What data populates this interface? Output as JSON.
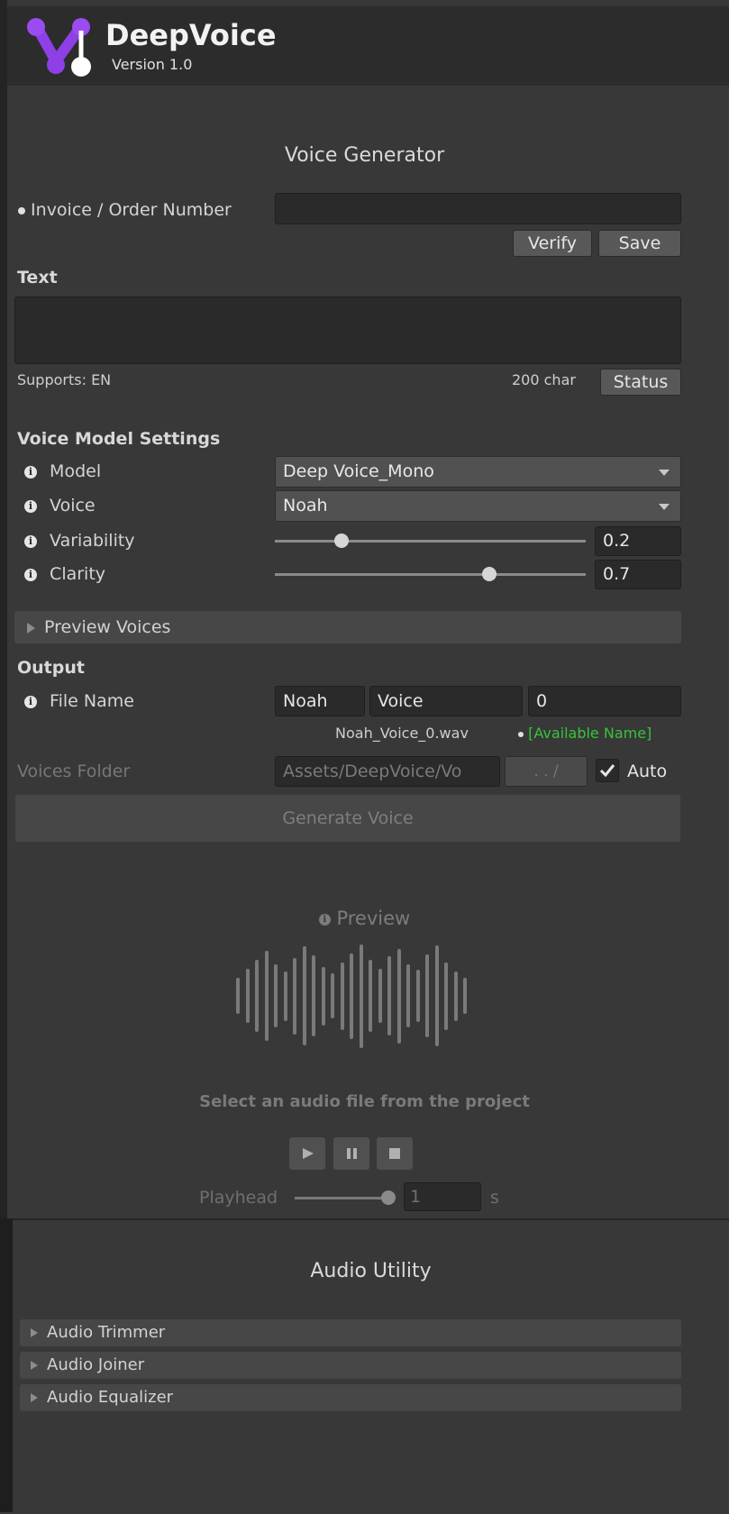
{
  "app": {
    "title": "DeepVoice",
    "version": "Version 1.0"
  },
  "generator": {
    "title": "Voice Generator",
    "invoice_label": "Invoice / Order Number",
    "invoice_value": "",
    "verify_label": "Verify",
    "save_label": "Save",
    "text_label": "Text",
    "text_value": "",
    "supports": "Supports: EN",
    "char_count": "200 char",
    "status_label": "Status"
  },
  "model_settings": {
    "title": "Voice Model Settings",
    "model_label": "Model",
    "model_value": "Deep Voice_Mono",
    "voice_label": "Voice",
    "voice_value": "Noah",
    "variability_label": "Variability",
    "variability_value": "0.2",
    "variability_fraction": 0.2,
    "clarity_label": "Clarity",
    "clarity_value": "0.7",
    "clarity_fraction": 0.7
  },
  "preview_voices_label": "Preview Voices",
  "output": {
    "title": "Output",
    "file_name_label": "File Name",
    "name_part1": "Noah",
    "name_part2": "Voice",
    "name_part3": "0",
    "file_preview": "Noah_Voice_0.wav",
    "availability": "[Available Name]",
    "folder_label": "Voices Folder",
    "folder_value": "Assets/DeepVoice/Vo",
    "browse_label": ". . /",
    "auto_label": "Auto",
    "auto_checked": true,
    "generate_label": "Generate Voice"
  },
  "preview": {
    "title": "Preview",
    "hint": "Select an audio file from the project",
    "playhead_label": "Playhead",
    "playhead_value": "1",
    "playhead_unit": "s"
  },
  "utility": {
    "title": "Audio Utility",
    "items": [
      "Audio Trimmer",
      "Audio Joiner",
      "Audio Equalizer"
    ]
  },
  "colors": {
    "accent_purple": "#8f3fe6",
    "available_green": "#36c33b",
    "background": "#383838"
  }
}
